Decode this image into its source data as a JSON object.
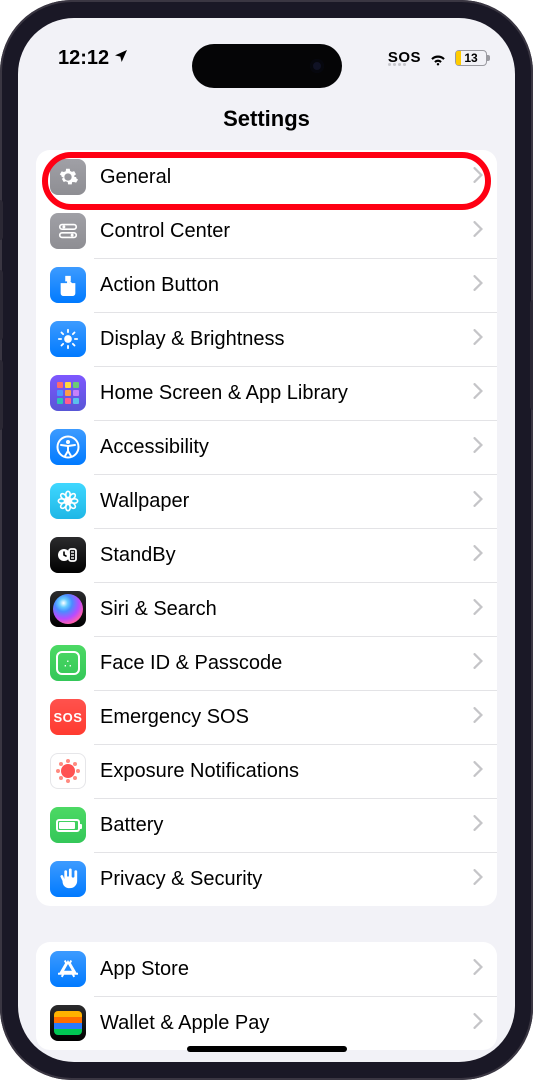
{
  "status": {
    "time": "12:12",
    "sos": "SOS",
    "battery_pct": "13",
    "battery_fill_pct": 16
  },
  "nav": {
    "title": "Settings"
  },
  "groups": [
    {
      "items": [
        {
          "id": "general",
          "label": "General",
          "icon": "gear",
          "bg": "bg-gray",
          "highlighted": true
        },
        {
          "id": "control-center",
          "label": "Control Center",
          "icon": "switches",
          "bg": "bg-gray"
        },
        {
          "id": "action-button",
          "label": "Action Button",
          "icon": "action",
          "bg": "bg-blue"
        },
        {
          "id": "display",
          "label": "Display & Brightness",
          "icon": "sun",
          "bg": "bg-blue"
        },
        {
          "id": "home-screen",
          "label": "Home Screen & App Library",
          "icon": "grid",
          "bg": "bg-purple"
        },
        {
          "id": "accessibility",
          "label": "Accessibility",
          "icon": "accessibility",
          "bg": "bg-blue"
        },
        {
          "id": "wallpaper",
          "label": "Wallpaper",
          "icon": "flower",
          "bg": "bg-cyan"
        },
        {
          "id": "standby",
          "label": "StandBy",
          "icon": "standby",
          "bg": "bg-black"
        },
        {
          "id": "siri",
          "label": "Siri & Search",
          "icon": "siri",
          "bg": "bg-black"
        },
        {
          "id": "faceid",
          "label": "Face ID & Passcode",
          "icon": "faceid",
          "bg": "bg-green"
        },
        {
          "id": "sos",
          "label": "Emergency SOS",
          "icon": "sos",
          "bg": "bg-red"
        },
        {
          "id": "exposure",
          "label": "Exposure Notifications",
          "icon": "exposure",
          "bg": "bg-white"
        },
        {
          "id": "battery",
          "label": "Battery",
          "icon": "battery",
          "bg": "bg-green"
        },
        {
          "id": "privacy",
          "label": "Privacy & Security",
          "icon": "hand",
          "bg": "bg-blue"
        }
      ]
    },
    {
      "items": [
        {
          "id": "app-store",
          "label": "App Store",
          "icon": "appstore",
          "bg": "bg-blue"
        },
        {
          "id": "wallet",
          "label": "Wallet & Apple Pay",
          "icon": "wallet",
          "bg": "bg-black"
        }
      ]
    }
  ]
}
